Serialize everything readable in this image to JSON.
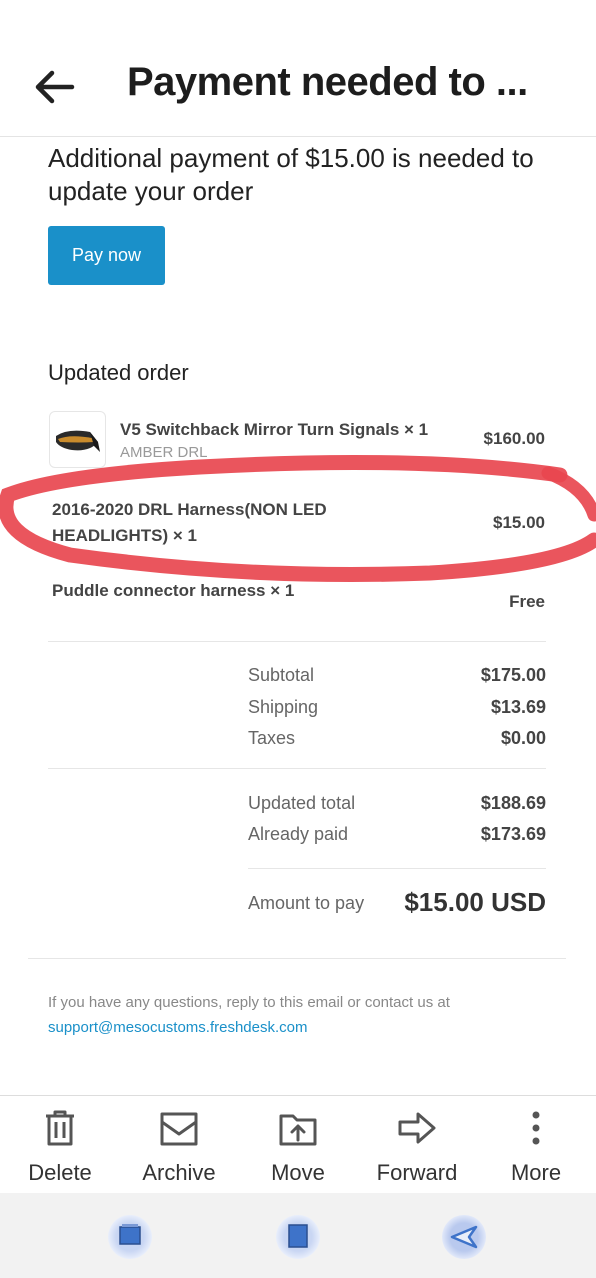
{
  "header": {
    "title": "Payment needed to ..."
  },
  "message": {
    "headline": "Additional payment of $15.00 is needed to update your order",
    "pay_button": "Pay now",
    "section_title": "Updated order"
  },
  "items": [
    {
      "name": "V5 Switchback Mirror Turn Signals × 1",
      "variant": "AMBER DRL",
      "price": "$160.00"
    },
    {
      "name": "2016-2020 DRL Harness(NON LED HEADLIGHTS) × 1",
      "price": "$15.00"
    },
    {
      "name": "Puddle connector harness × 1",
      "price": "Free"
    }
  ],
  "summary": {
    "subtotal_label": "Subtotal",
    "subtotal": "$175.00",
    "shipping_label": "Shipping",
    "shipping": "$13.69",
    "taxes_label": "Taxes",
    "taxes": "$0.00",
    "updated_total_label": "Updated total",
    "updated_total": "$188.69",
    "already_paid_label": "Already paid",
    "already_paid": "$173.69",
    "amount_to_pay_label": "Amount to pay",
    "amount_to_pay": "$15.00 USD"
  },
  "footer": {
    "text": "If you have any questions, reply to this email or contact us at",
    "link": "support@mesocustoms.freshdesk.com"
  },
  "toolbar": {
    "delete": "Delete",
    "archive": "Archive",
    "move": "Move",
    "forward": "Forward",
    "more": "More"
  },
  "colors": {
    "accent": "#1a90c9",
    "annotation": "#e8474f"
  },
  "icons": [
    "back-arrow-icon",
    "delete-icon",
    "archive-icon",
    "move-icon",
    "forward-icon",
    "more-icon",
    "recent-apps-icon",
    "home-icon",
    "back-icon"
  ]
}
